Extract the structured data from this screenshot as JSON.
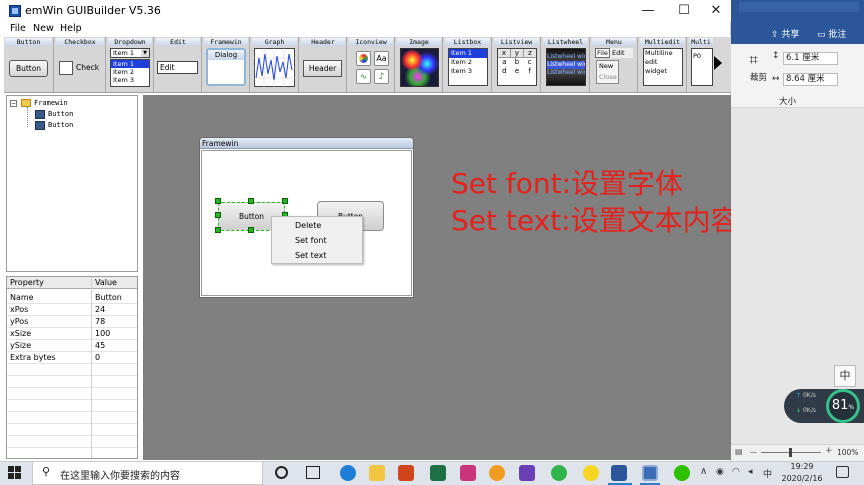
{
  "app": {
    "title": "emWin GUIBuilder V5.36",
    "minimize": "—",
    "maximize": "☐",
    "close": "✕"
  },
  "menu": [
    "File",
    "New",
    "Help"
  ],
  "toolbar": {
    "button": {
      "header": "Button",
      "label": "Button"
    },
    "checkbox": {
      "header": "Checkbox",
      "label": "Check"
    },
    "dropdown": {
      "header": "Dropdown",
      "value": "Item 1",
      "items": [
        "Item 1",
        "Item 2",
        "Item 3"
      ]
    },
    "edit": {
      "header": "Edit",
      "value": "Edit"
    },
    "framewin": {
      "header": "Framewin",
      "label": "Dialog"
    },
    "graph": {
      "header": "Graph"
    },
    "header": {
      "header": "Header",
      "label": "Header"
    },
    "iconview": {
      "header": "Iconview",
      "aa": "Aa"
    },
    "image": {
      "header": "Image"
    },
    "listbox": {
      "header": "Listbox",
      "items": [
        "Item 1",
        "Item 2",
        "Item 3"
      ]
    },
    "listview": {
      "header": "Listview",
      "rows": [
        [
          "x",
          "y",
          "z"
        ],
        [
          "a",
          "b",
          "c"
        ],
        [
          "d",
          "e",
          "f"
        ]
      ]
    },
    "listwheel": {
      "header": "Listwheel",
      "items": [
        "Listwheel wid",
        "Listwheel wid",
        "Listwheel wid"
      ]
    },
    "menu": {
      "header": "Menu",
      "file": "File",
      "edit": "Edit",
      "new": "New",
      "close": "Close"
    },
    "multiedit": {
      "header": "Multiedit",
      "lines": [
        "Multiline",
        "edit",
        "widget"
      ]
    },
    "multipage": {
      "header": "Multi",
      "tab": "P0"
    }
  },
  "tree": {
    "root": "Framewin",
    "children": [
      "Button",
      "Button"
    ]
  },
  "properties": {
    "headers": [
      "Property",
      "Value"
    ],
    "rows": [
      [
        "Name",
        "Button"
      ],
      [
        "xPos",
        "24"
      ],
      [
        "yPos",
        "78"
      ],
      [
        "xSize",
        "100"
      ],
      [
        "ySize",
        "45"
      ],
      [
        "Extra bytes",
        "0"
      ]
    ]
  },
  "framewin": {
    "title": "Framewin",
    "button1": "Button",
    "button2": "Button"
  },
  "context_menu": [
    "Delete",
    "Set font",
    "Set text"
  ],
  "annotation": {
    "line1": "Set font:设置字体",
    "line2": "Set text:设置文本内容"
  },
  "word": {
    "share": "共享",
    "comment": "批注",
    "crop": "裁剪",
    "height": "6.1 厘米",
    "width": "8.64 厘米",
    "size_group": "大小",
    "ime": "中",
    "zoom": "100%",
    "zoom_minus": "－",
    "zoom_plus": "+"
  },
  "widget": {
    "percent": "81",
    "percent_sign": "%",
    "up": "0K/s",
    "down": "0K/s"
  },
  "taskbar": {
    "search_placeholder": "在这里输入你要搜索的内容",
    "time": "19:29",
    "date": "2020/2/16",
    "tray_ime": "中"
  },
  "colors": {
    "annotation": "#e4211b",
    "selection": "#1f3fdc",
    "handle": "#25b61f",
    "word_blue": "#2b579a"
  }
}
